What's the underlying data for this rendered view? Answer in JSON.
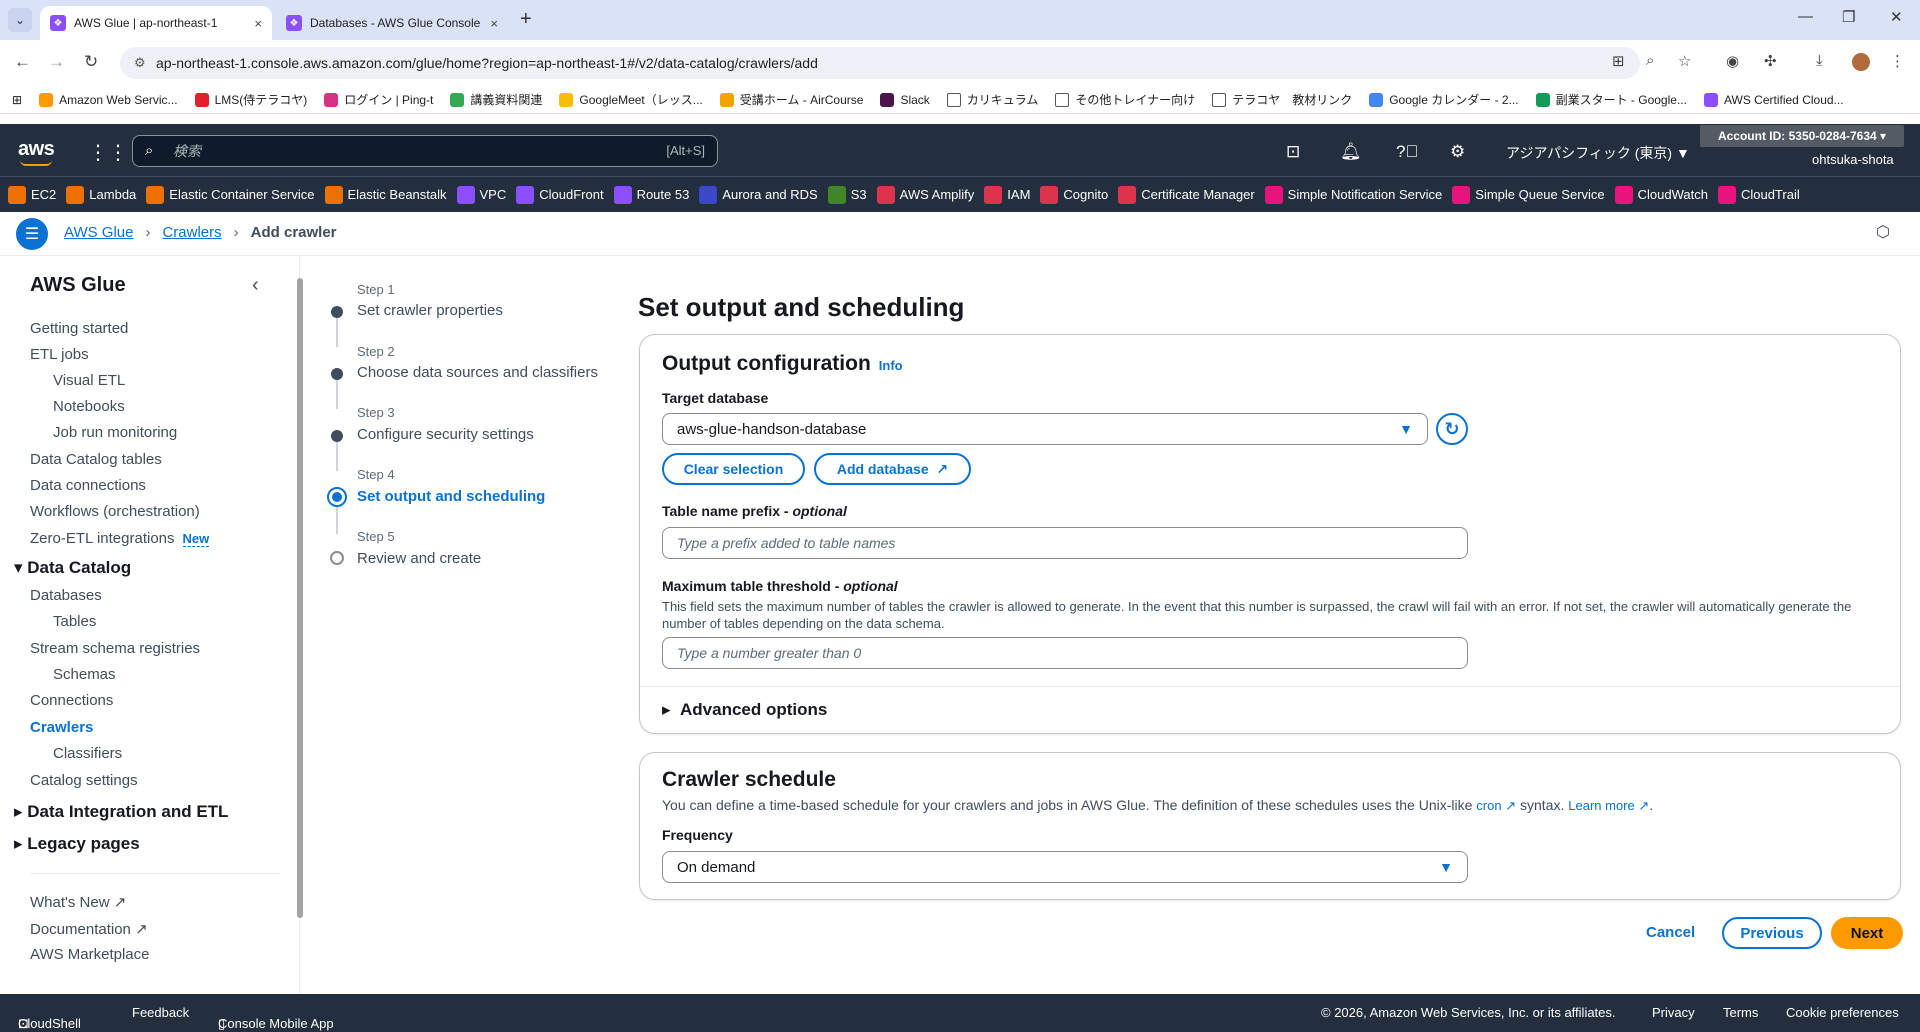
{
  "browser": {
    "tabs": [
      {
        "title": "AWS Glue | ap-northeast-1",
        "close": "×"
      },
      {
        "title": "Databases - AWS Glue Console",
        "close": "×"
      }
    ],
    "url": "ap-northeast-1.console.aws.amazon.com/glue/home?region=ap-northeast-1#/v2/data-catalog/crawlers/add",
    "bookmarks": [
      {
        "label": "Amazon Web Servic...",
        "color": "#ff9900"
      },
      {
        "label": "LMS(侍テラコヤ)",
        "color": "#e0202a"
      },
      {
        "label": "ログイン | Ping-t",
        "color": "#d63384"
      },
      {
        "label": "講義資料関連",
        "color": "#34a853"
      },
      {
        "label": "GoogleMeet（レッス...",
        "color": "#fbbc04"
      },
      {
        "label": "受講ホーム - AirCourse",
        "color": "#f4a300"
      },
      {
        "label": "Slack",
        "color": "#4a154b"
      },
      {
        "label": "カリキュラム",
        "color": "#ffffff"
      },
      {
        "label": "その他トレイナー向け",
        "color": "#ffffff"
      },
      {
        "label": "テラコヤ　教材リンク",
        "color": "#ffffff"
      },
      {
        "label": "Google カレンダー - 2...",
        "color": "#4285f4"
      },
      {
        "label": "副業スタート - Google...",
        "color": "#0f9d58"
      },
      {
        "label": "AWS Certified Cloud...",
        "color": "#8c4fff"
      }
    ]
  },
  "aws_header": {
    "logo": "aws",
    "search_placeholder": "検索",
    "search_hint": "[Alt+S]",
    "region": "アジアパシフィック (東京) ▼",
    "account": "Account ID: 5350-0284-7634 ▾",
    "user": "ohtsuka-shota"
  },
  "services": [
    {
      "label": "EC2",
      "color": "#ed7100"
    },
    {
      "label": "Lambda",
      "color": "#ed7100"
    },
    {
      "label": "Elastic Container Service",
      "color": "#ed7100"
    },
    {
      "label": "Elastic Beanstalk",
      "color": "#ed7100"
    },
    {
      "label": "VPC",
      "color": "#8c4fff"
    },
    {
      "label": "CloudFront",
      "color": "#8c4fff"
    },
    {
      "label": "Route 53",
      "color": "#8c4fff"
    },
    {
      "label": "Aurora and RDS",
      "color": "#3b48cc"
    },
    {
      "label": "S3",
      "color": "#3f8624"
    },
    {
      "label": "AWS Amplify",
      "color": "#dd344c"
    },
    {
      "label": "IAM",
      "color": "#dd344c"
    },
    {
      "label": "Cognito",
      "color": "#dd344c"
    },
    {
      "label": "Certificate Manager",
      "color": "#dd344c"
    },
    {
      "label": "Simple Notification Service",
      "color": "#e7157b"
    },
    {
      "label": "Simple Queue Service",
      "color": "#e7157b"
    },
    {
      "label": "CloudWatch",
      "color": "#e7157b"
    },
    {
      "label": "CloudTrail",
      "color": "#e7157b"
    }
  ],
  "breadcrumb": {
    "root": "AWS Glue",
    "parent": "Crawlers",
    "current": "Add crawler"
  },
  "leftnav": {
    "title": "AWS Glue",
    "getting_started": "Getting started",
    "etl_jobs": "ETL jobs",
    "visual_etl": "Visual ETL",
    "notebooks": "Notebooks",
    "job_run_monitoring": "Job run monitoring",
    "data_catalog_tables": "Data Catalog tables",
    "data_connections": "Data connections",
    "workflows": "Workflows (orchestration)",
    "zero_etl": "Zero-ETL integrations",
    "new_badge": "New",
    "data_catalog": "Data Catalog",
    "databases": "Databases",
    "tables": "Tables",
    "stream_schema": "Stream schema registries",
    "schemas": "Schemas",
    "connections": "Connections",
    "crawlers": "Crawlers",
    "classifiers": "Classifiers",
    "catalog_settings": "Catalog settings",
    "data_integration": "Data Integration and ETL",
    "legacy": "Legacy pages",
    "whats_new": "What's New",
    "documentation": "Documentation",
    "marketplace": "AWS Marketplace"
  },
  "steps": [
    {
      "label": "Step 1",
      "name": "Set crawler properties"
    },
    {
      "label": "Step 2",
      "name": "Choose data sources and classifiers"
    },
    {
      "label": "Step 3",
      "name": "Configure security settings"
    },
    {
      "label": "Step 4",
      "name": "Set output and scheduling"
    },
    {
      "label": "Step 5",
      "name": "Review and create"
    }
  ],
  "main": {
    "title": "Set output and scheduling",
    "output": {
      "title": "Output configuration",
      "info": "Info",
      "target_db_label": "Target database",
      "target_db_value": "aws-glue-handson-database",
      "clear_selection": "Clear selection",
      "add_database": "Add database",
      "prefix_label": "Table name prefix - ",
      "prefix_optional": "optional",
      "prefix_placeholder": "Type a prefix added to table names",
      "threshold_label": "Maximum table threshold - ",
      "threshold_optional": "optional",
      "threshold_desc": "This field sets the maximum number of tables the crawler is allowed to generate. In the event that this number is surpassed, the crawl will fail with an error. If not set, the crawler will automatically generate the number of tables depending on the data schema.",
      "threshold_placeholder": "Type a number greater than 0",
      "advanced": "Advanced options"
    },
    "schedule": {
      "title": "Crawler schedule",
      "desc_pre": "You can define a time-based schedule for your crawlers and jobs in AWS Glue. The definition of these schedules uses the Unix-like",
      "cron": "cron",
      "desc_mid": "syntax.",
      "learn_more": "Learn more",
      "frequency_label": "Frequency",
      "frequency_value": "On demand"
    },
    "actions": {
      "cancel": "Cancel",
      "previous": "Previous",
      "next": "Next"
    }
  },
  "footer": {
    "cloudshell": "CloudShell",
    "feedback": "Feedback",
    "mobile": "Console Mobile App",
    "copyright": "© 2026, Amazon Web Services, Inc. or its affiliates.",
    "privacy": "Privacy",
    "terms": "Terms",
    "cookie": "Cookie preferences"
  }
}
